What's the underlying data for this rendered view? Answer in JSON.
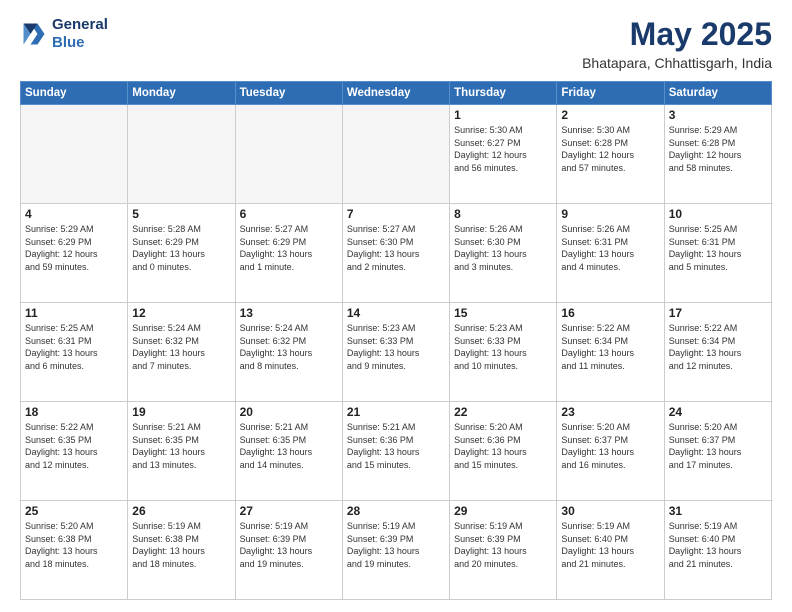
{
  "header": {
    "logo_line1": "General",
    "logo_line2": "Blue",
    "title": "May 2025",
    "location": "Bhatapara, Chhattisgarh, India"
  },
  "weekdays": [
    "Sunday",
    "Monday",
    "Tuesday",
    "Wednesday",
    "Thursday",
    "Friday",
    "Saturday"
  ],
  "weeks": [
    [
      {
        "day": "",
        "content": "",
        "empty": true
      },
      {
        "day": "",
        "content": "",
        "empty": true
      },
      {
        "day": "",
        "content": "",
        "empty": true
      },
      {
        "day": "",
        "content": "",
        "empty": true
      },
      {
        "day": "1",
        "content": "Sunrise: 5:30 AM\nSunset: 6:27 PM\nDaylight: 12 hours\nand 56 minutes."
      },
      {
        "day": "2",
        "content": "Sunrise: 5:30 AM\nSunset: 6:28 PM\nDaylight: 12 hours\nand 57 minutes."
      },
      {
        "day": "3",
        "content": "Sunrise: 5:29 AM\nSunset: 6:28 PM\nDaylight: 12 hours\nand 58 minutes."
      }
    ],
    [
      {
        "day": "4",
        "content": "Sunrise: 5:29 AM\nSunset: 6:29 PM\nDaylight: 12 hours\nand 59 minutes."
      },
      {
        "day": "5",
        "content": "Sunrise: 5:28 AM\nSunset: 6:29 PM\nDaylight: 13 hours\nand 0 minutes."
      },
      {
        "day": "6",
        "content": "Sunrise: 5:27 AM\nSunset: 6:29 PM\nDaylight: 13 hours\nand 1 minute."
      },
      {
        "day": "7",
        "content": "Sunrise: 5:27 AM\nSunset: 6:30 PM\nDaylight: 13 hours\nand 2 minutes."
      },
      {
        "day": "8",
        "content": "Sunrise: 5:26 AM\nSunset: 6:30 PM\nDaylight: 13 hours\nand 3 minutes."
      },
      {
        "day": "9",
        "content": "Sunrise: 5:26 AM\nSunset: 6:31 PM\nDaylight: 13 hours\nand 4 minutes."
      },
      {
        "day": "10",
        "content": "Sunrise: 5:25 AM\nSunset: 6:31 PM\nDaylight: 13 hours\nand 5 minutes."
      }
    ],
    [
      {
        "day": "11",
        "content": "Sunrise: 5:25 AM\nSunset: 6:31 PM\nDaylight: 13 hours\nand 6 minutes."
      },
      {
        "day": "12",
        "content": "Sunrise: 5:24 AM\nSunset: 6:32 PM\nDaylight: 13 hours\nand 7 minutes."
      },
      {
        "day": "13",
        "content": "Sunrise: 5:24 AM\nSunset: 6:32 PM\nDaylight: 13 hours\nand 8 minutes."
      },
      {
        "day": "14",
        "content": "Sunrise: 5:23 AM\nSunset: 6:33 PM\nDaylight: 13 hours\nand 9 minutes."
      },
      {
        "day": "15",
        "content": "Sunrise: 5:23 AM\nSunset: 6:33 PM\nDaylight: 13 hours\nand 10 minutes."
      },
      {
        "day": "16",
        "content": "Sunrise: 5:22 AM\nSunset: 6:34 PM\nDaylight: 13 hours\nand 11 minutes."
      },
      {
        "day": "17",
        "content": "Sunrise: 5:22 AM\nSunset: 6:34 PM\nDaylight: 13 hours\nand 12 minutes."
      }
    ],
    [
      {
        "day": "18",
        "content": "Sunrise: 5:22 AM\nSunset: 6:35 PM\nDaylight: 13 hours\nand 12 minutes."
      },
      {
        "day": "19",
        "content": "Sunrise: 5:21 AM\nSunset: 6:35 PM\nDaylight: 13 hours\nand 13 minutes."
      },
      {
        "day": "20",
        "content": "Sunrise: 5:21 AM\nSunset: 6:35 PM\nDaylight: 13 hours\nand 14 minutes."
      },
      {
        "day": "21",
        "content": "Sunrise: 5:21 AM\nSunset: 6:36 PM\nDaylight: 13 hours\nand 15 minutes."
      },
      {
        "day": "22",
        "content": "Sunrise: 5:20 AM\nSunset: 6:36 PM\nDaylight: 13 hours\nand 15 minutes."
      },
      {
        "day": "23",
        "content": "Sunrise: 5:20 AM\nSunset: 6:37 PM\nDaylight: 13 hours\nand 16 minutes."
      },
      {
        "day": "24",
        "content": "Sunrise: 5:20 AM\nSunset: 6:37 PM\nDaylight: 13 hours\nand 17 minutes."
      }
    ],
    [
      {
        "day": "25",
        "content": "Sunrise: 5:20 AM\nSunset: 6:38 PM\nDaylight: 13 hours\nand 18 minutes."
      },
      {
        "day": "26",
        "content": "Sunrise: 5:19 AM\nSunset: 6:38 PM\nDaylight: 13 hours\nand 18 minutes."
      },
      {
        "day": "27",
        "content": "Sunrise: 5:19 AM\nSunset: 6:39 PM\nDaylight: 13 hours\nand 19 minutes."
      },
      {
        "day": "28",
        "content": "Sunrise: 5:19 AM\nSunset: 6:39 PM\nDaylight: 13 hours\nand 19 minutes."
      },
      {
        "day": "29",
        "content": "Sunrise: 5:19 AM\nSunset: 6:39 PM\nDaylight: 13 hours\nand 20 minutes."
      },
      {
        "day": "30",
        "content": "Sunrise: 5:19 AM\nSunset: 6:40 PM\nDaylight: 13 hours\nand 21 minutes."
      },
      {
        "day": "31",
        "content": "Sunrise: 5:19 AM\nSunset: 6:40 PM\nDaylight: 13 hours\nand 21 minutes."
      }
    ]
  ]
}
